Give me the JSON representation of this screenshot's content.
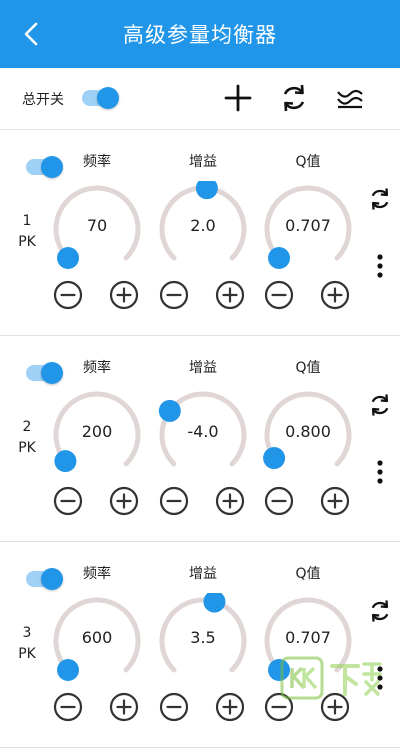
{
  "header": {
    "title": "高级参量均衡器"
  },
  "global": {
    "master_switch_label": "总开关",
    "master_switch_on": true
  },
  "labels": {
    "freq": "频率",
    "gain": "增益",
    "q": "Q值"
  },
  "bands": [
    {
      "number": "1",
      "type": "PK",
      "enabled": true,
      "freq": "70",
      "gain": "2.0",
      "q": "0.707"
    },
    {
      "number": "2",
      "type": "PK",
      "enabled": true,
      "freq": "200",
      "gain": "-4.0",
      "q": "0.800"
    },
    {
      "number": "3",
      "type": "PK",
      "enabled": true,
      "freq": "600",
      "gain": "3.5",
      "q": "0.707"
    }
  ],
  "knob_levels": [
    {
      "freq": 0.0,
      "gain": 0.52,
      "q": 0.0
    },
    {
      "freq": 0.02,
      "gain": 0.3,
      "q": 0.04
    },
    {
      "freq": 0.0,
      "gain": 0.56,
      "q": 0.0
    }
  ],
  "colors": {
    "accent": "#2196e9",
    "track": "#e0d6d6",
    "toggle_track": "#9fd0f5"
  },
  "watermark": {
    "text": "KK下载"
  }
}
